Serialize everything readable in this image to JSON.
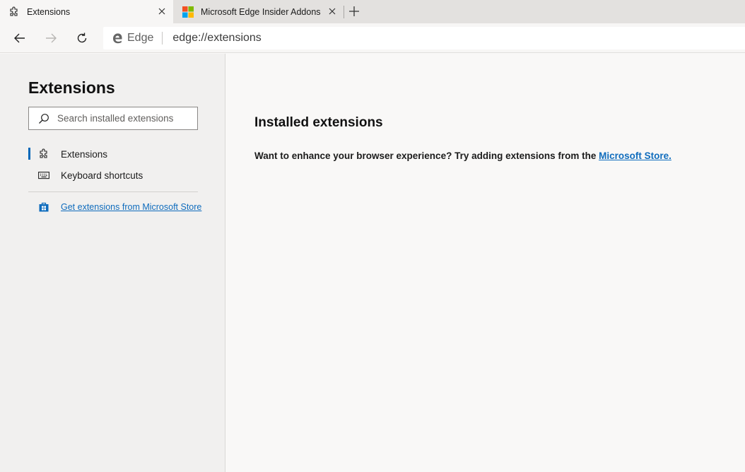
{
  "tabs": [
    {
      "title": "Extensions",
      "icon": "puzzle-icon",
      "active": true
    },
    {
      "title": "Microsoft Edge Insider Addons",
      "icon": "microsoft-logo-icon",
      "active": false
    }
  ],
  "toolbar": {
    "site_label": "Edge",
    "url": "edge://extensions"
  },
  "sidebar": {
    "title": "Extensions",
    "search_placeholder": "Search installed extensions",
    "items": [
      {
        "label": "Extensions",
        "icon": "puzzle-icon",
        "selected": true
      },
      {
        "label": "Keyboard shortcuts",
        "icon": "keyboard-icon",
        "selected": false
      }
    ],
    "store_link": "Get extensions from Microsoft Store"
  },
  "main": {
    "title": "Installed extensions",
    "message": "Want to enhance your browser experience? Try adding extensions from the ",
    "link": "Microsoft Store."
  },
  "colors": {
    "accent": "#0067b8",
    "link": "#0f6cbd",
    "ms_red": "#f25022",
    "ms_green": "#7fba00",
    "ms_blue": "#00a4ef",
    "ms_yellow": "#ffb900"
  }
}
